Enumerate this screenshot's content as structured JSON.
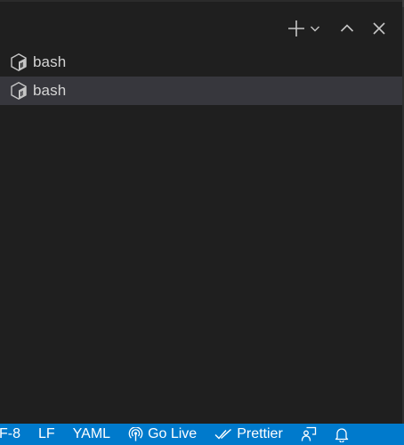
{
  "panel": {
    "actions": {
      "new_terminal_icon": "plus-icon",
      "dropdown_icon": "chevron-down-icon",
      "maximize_icon": "chevron-up-icon",
      "close_icon": "close-icon"
    },
    "terminals": [
      {
        "label": "bash",
        "icon": "terminal-bash-icon",
        "selected": false
      },
      {
        "label": "bash",
        "icon": "terminal-bash-icon",
        "selected": true
      }
    ]
  },
  "statusbar": {
    "encoding": "F-8",
    "eol": "LF",
    "language": "YAML",
    "go_live": "Go Live",
    "prettier": "Prettier",
    "feedback_icon": "feedback-icon",
    "notifications_icon": "bell-icon",
    "background": "#007acc"
  }
}
